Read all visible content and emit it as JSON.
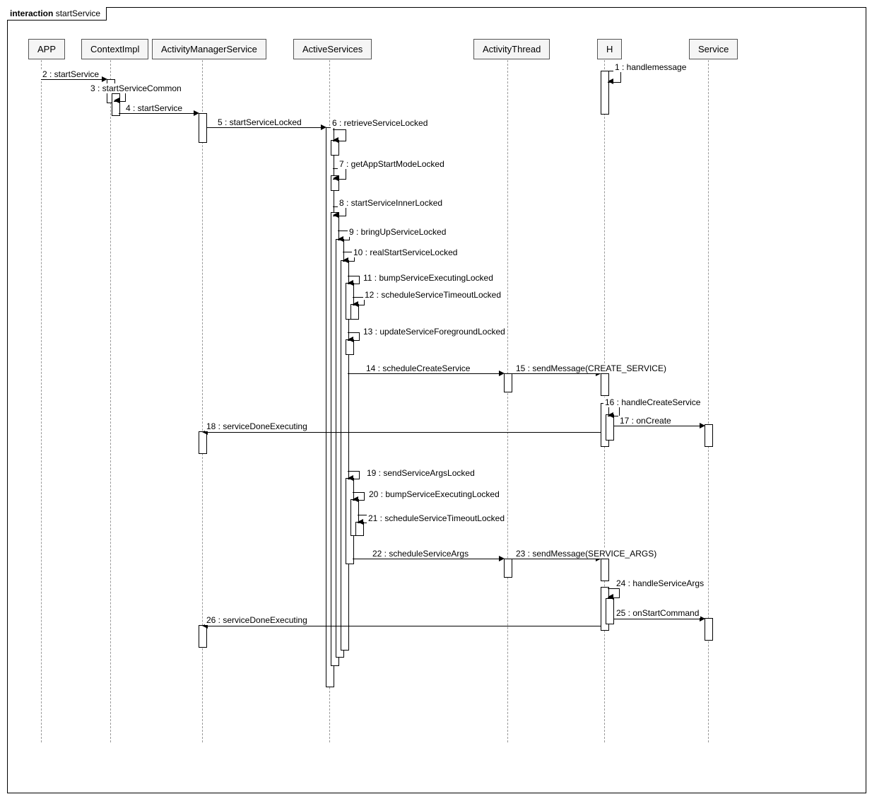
{
  "frame": {
    "label_prefix": "interaction",
    "label_name": "startService"
  },
  "participants": {
    "app": "APP",
    "contextimpl": "ContextImpl",
    "ams": "ActivityManagerService",
    "activeservices": "ActiveServices",
    "activitythread": "ActivityThread",
    "h": "H",
    "service": "Service"
  },
  "messages": {
    "m1": "1 : handlemessage",
    "m2": "2 : startService",
    "m3": "3 : startServiceCommon",
    "m4": "4 : startService",
    "m5": "5 : startServiceLocked",
    "m6": "6 : retrieveServiceLocked",
    "m7": "7 : getAppStartModeLocked",
    "m8": "8 : startServiceInnerLocked",
    "m9": "9 : bringUpServiceLocked",
    "m10": "10 : realStartServiceLocked",
    "m11": "11 : bumpServiceExecutingLocked",
    "m12": "12 : scheduleServiceTimeoutLocked",
    "m13": "13 : updateServiceForegroundLocked",
    "m14": "14 : scheduleCreateService",
    "m15": "15 : sendMessage(CREATE_SERVICE)",
    "m16": "16 : handleCreateService",
    "m17": "17 : onCreate",
    "m18": "18 : serviceDoneExecuting",
    "m19": "19 : sendServiceArgsLocked",
    "m20": "20 : bumpServiceExecutingLocked",
    "m21": "21 : scheduleServiceTimeoutLocked",
    "m22": "22 : scheduleServiceArgs",
    "m23": "23 : sendMessage(SERVICE_ARGS)",
    "m24": "24 : handleServiceArgs",
    "m25": "25 : onStartCommand",
    "m26": "26 : serviceDoneExecuting"
  },
  "chart_data": {
    "type": "sequence_diagram",
    "title": "interaction startService",
    "participants": [
      "APP",
      "ContextImpl",
      "ActivityManagerService",
      "ActiveServices",
      "ActivityThread",
      "H",
      "Service"
    ],
    "messages": [
      {
        "n": 1,
        "from": "H",
        "to": "H",
        "label": "handlemessage"
      },
      {
        "n": 2,
        "from": "APP",
        "to": "ContextImpl",
        "label": "startService"
      },
      {
        "n": 3,
        "from": "ContextImpl",
        "to": "ContextImpl",
        "label": "startServiceCommon"
      },
      {
        "n": 4,
        "from": "ContextImpl",
        "to": "ActivityManagerService",
        "label": "startService"
      },
      {
        "n": 5,
        "from": "ActivityManagerService",
        "to": "ActiveServices",
        "label": "startServiceLocked"
      },
      {
        "n": 6,
        "from": "ActiveServices",
        "to": "ActiveServices",
        "label": "retrieveServiceLocked"
      },
      {
        "n": 7,
        "from": "ActiveServices",
        "to": "ActiveServices",
        "label": "getAppStartModeLocked"
      },
      {
        "n": 8,
        "from": "ActiveServices",
        "to": "ActiveServices",
        "label": "startServiceInnerLocked"
      },
      {
        "n": 9,
        "from": "ActiveServices",
        "to": "ActiveServices",
        "label": "bringUpServiceLocked"
      },
      {
        "n": 10,
        "from": "ActiveServices",
        "to": "ActiveServices",
        "label": "realStartServiceLocked"
      },
      {
        "n": 11,
        "from": "ActiveServices",
        "to": "ActiveServices",
        "label": "bumpServiceExecutingLocked"
      },
      {
        "n": 12,
        "from": "ActiveServices",
        "to": "ActiveServices",
        "label": "scheduleServiceTimeoutLocked"
      },
      {
        "n": 13,
        "from": "ActiveServices",
        "to": "ActiveServices",
        "label": "updateServiceForegroundLocked"
      },
      {
        "n": 14,
        "from": "ActiveServices",
        "to": "ActivityThread",
        "label": "scheduleCreateService"
      },
      {
        "n": 15,
        "from": "ActivityThread",
        "to": "H",
        "label": "sendMessage(CREATE_SERVICE)"
      },
      {
        "n": 16,
        "from": "H",
        "to": "ActivityThread",
        "label": "handleCreateService"
      },
      {
        "n": 17,
        "from": "ActivityThread",
        "to": "Service",
        "label": "onCreate"
      },
      {
        "n": 18,
        "from": "ActivityThread",
        "to": "ActivityManagerService",
        "label": "serviceDoneExecuting"
      },
      {
        "n": 19,
        "from": "ActiveServices",
        "to": "ActiveServices",
        "label": "sendServiceArgsLocked"
      },
      {
        "n": 20,
        "from": "ActiveServices",
        "to": "ActiveServices",
        "label": "bumpServiceExecutingLocked"
      },
      {
        "n": 21,
        "from": "ActiveServices",
        "to": "ActiveServices",
        "label": "scheduleServiceTimeoutLocked"
      },
      {
        "n": 22,
        "from": "ActiveServices",
        "to": "ActivityThread",
        "label": "scheduleServiceArgs"
      },
      {
        "n": 23,
        "from": "ActivityThread",
        "to": "H",
        "label": "sendMessage(SERVICE_ARGS)"
      },
      {
        "n": 24,
        "from": "H",
        "to": "ActivityThread",
        "label": "handleServiceArgs"
      },
      {
        "n": 25,
        "from": "ActivityThread",
        "to": "Service",
        "label": "onStartCommand"
      },
      {
        "n": 26,
        "from": "ActivityThread",
        "to": "ActivityManagerService",
        "label": "serviceDoneExecuting"
      }
    ]
  }
}
